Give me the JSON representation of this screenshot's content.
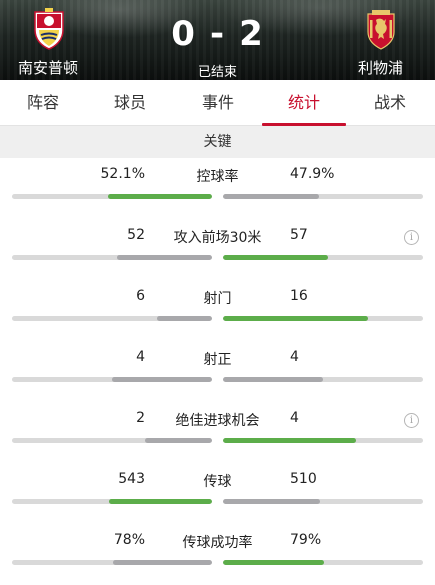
{
  "match": {
    "home_team": "南安普顿",
    "away_team": "利物浦",
    "home_score": "0",
    "score_separator": "-",
    "away_score": "2",
    "status": "已结束",
    "home_crest_icon": "southampton-crest-icon",
    "away_crest_icon": "liverpool-crest-icon"
  },
  "tabs": [
    {
      "label": "阵容",
      "active": false
    },
    {
      "label": "球员",
      "active": false
    },
    {
      "label": "事件",
      "active": false
    },
    {
      "label": "统计",
      "active": true
    },
    {
      "label": "战术",
      "active": false
    }
  ],
  "section": {
    "title": "关键"
  },
  "colors": {
    "accent": "#c8102e",
    "leading_bar": "#5cad4a",
    "trailing_bar": "#a8a8ab",
    "track": "#d9d9d9"
  },
  "stats": [
    {
      "label": "控球率",
      "home": "52.1%",
      "away": "47.9%",
      "home_ratio": 0.521,
      "away_ratio": 0.479,
      "leader": "home",
      "info": false
    },
    {
      "label": "攻入前场30米",
      "home": "52",
      "away": "57",
      "home_ratio": 0.477,
      "away_ratio": 0.523,
      "leader": "away",
      "info": true
    },
    {
      "label": "射门",
      "home": "6",
      "away": "16",
      "home_ratio": 0.273,
      "away_ratio": 0.727,
      "leader": "away",
      "info": false
    },
    {
      "label": "射正",
      "home": "4",
      "away": "4",
      "home_ratio": 0.5,
      "away_ratio": 0.5,
      "leader": "none",
      "info": false
    },
    {
      "label": "绝佳进球机会",
      "home": "2",
      "away": "4",
      "home_ratio": 0.333,
      "away_ratio": 0.667,
      "leader": "away",
      "info": true
    },
    {
      "label": "传球",
      "home": "543",
      "away": "510",
      "home_ratio": 0.516,
      "away_ratio": 0.484,
      "leader": "home",
      "info": false
    },
    {
      "label": "传球成功率",
      "home": "78%",
      "away": "79%",
      "home_ratio": 0.497,
      "away_ratio": 0.503,
      "leader": "away",
      "info": false
    }
  ]
}
